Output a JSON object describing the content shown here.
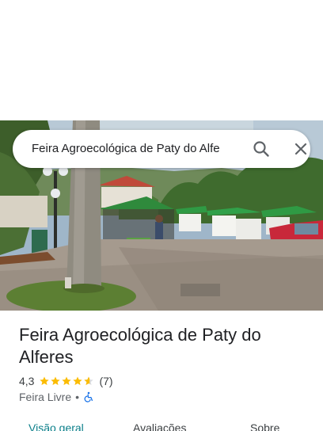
{
  "search": {
    "query": "Feira Agroecológica de Paty do Alfe"
  },
  "place": {
    "name": "Feira Agroecológica de Paty do Alferes",
    "rating": "4,3",
    "stars": 4.3,
    "review_count": "(7)",
    "category": "Feira Livre",
    "separator": "•"
  },
  "tabs": [
    {
      "label": "Visão geral",
      "active": true
    },
    {
      "label": "Avaliações",
      "active": false
    },
    {
      "label": "Sobre",
      "active": false
    }
  ],
  "colors": {
    "accent": "#0b7f8a",
    "star": "#fbbc04",
    "accessible": "#1a73e8"
  }
}
